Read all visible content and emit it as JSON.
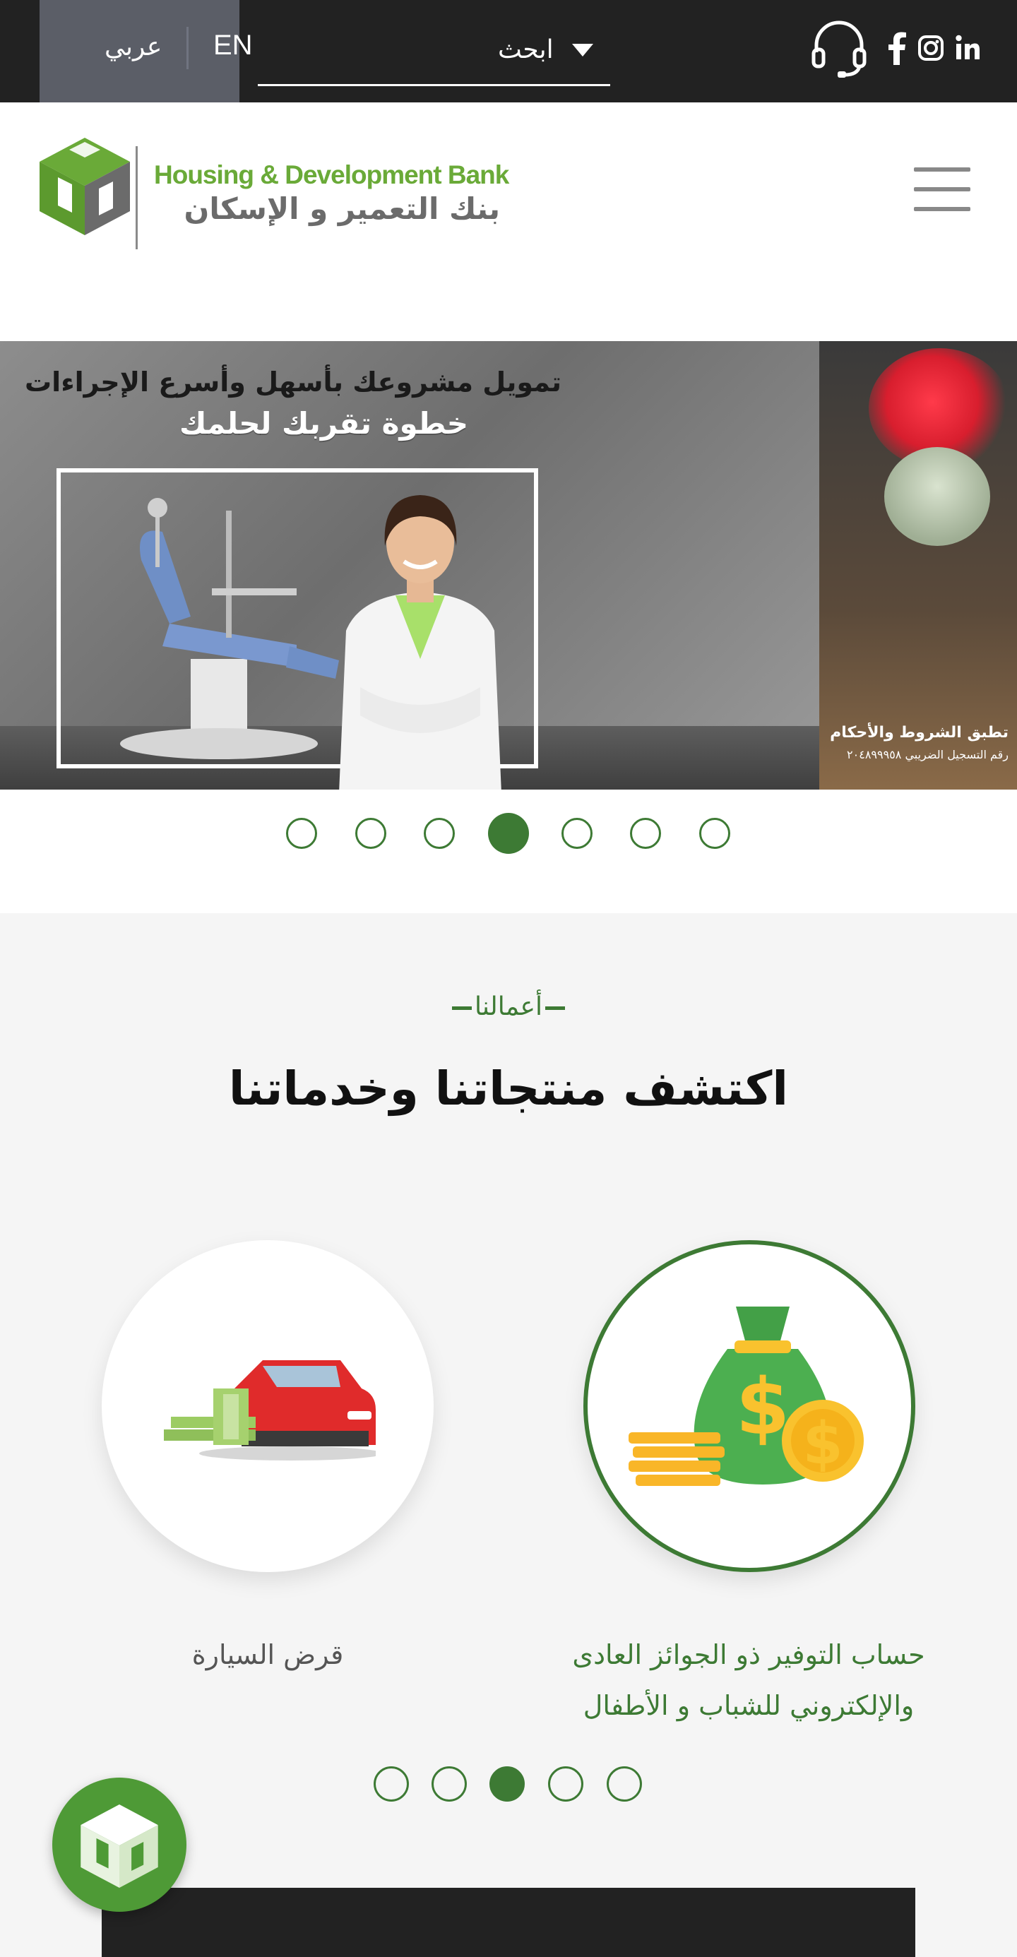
{
  "topbar": {
    "lang_ar": "عربي",
    "lang_en": "EN",
    "search_label": "ابحث",
    "icons": [
      "headset-icon",
      "facebook-icon",
      "instagram-icon",
      "linkedin-icon"
    ]
  },
  "header": {
    "logo_en": "Housing & Development Bank",
    "logo_ar": "بنك التعمير و الإسكان",
    "menu_icon": "hamburger-icon"
  },
  "hero": {
    "title": "تمويل مشروعك بأسهل وأسرع الإجراءات",
    "subtitle": "خطوة تقربك لحلمك",
    "side_terms": "تطبق الشروط والأحكام",
    "side_reg": "رقم التسجيل الضريبي ٢٠٤٨٩٩٩٥٨",
    "slide_count": 7,
    "active_slide": 4
  },
  "products": {
    "eyebrow": "أعمالنا",
    "title": "اكتشف منتجاتنا وخدماتنا",
    "items": [
      {
        "label": "حساب التوفير ذو الجوائز العادى والإلكتروني للشباب و الأطفال",
        "icon": "money-bag-icon",
        "featured": true
      },
      {
        "label": "قرض السيارة",
        "icon": "car-loan-icon",
        "featured": false
      }
    ],
    "slide_count": 5,
    "active_slide": 3
  },
  "colors": {
    "brand_green": "#3d7a34",
    "logo_green": "#6aaa38",
    "topbar": "#222222",
    "lang_box": "#5b5e67"
  }
}
